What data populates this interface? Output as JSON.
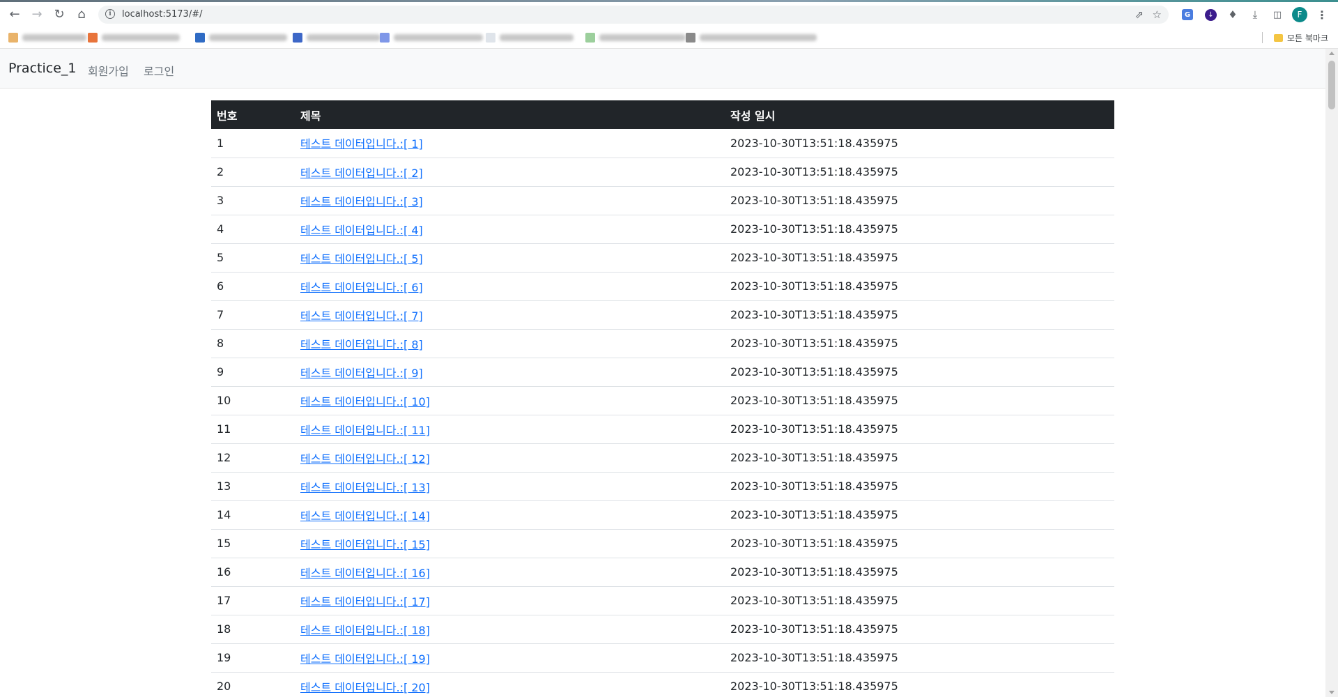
{
  "browser": {
    "url": "localhost:5173/#/",
    "bookmarks_folder": "모든 북마크",
    "profile_initial": "F",
    "icons": [
      "back-icon",
      "forward-icon",
      "reload-icon",
      "home-icon",
      "info-icon",
      "share-icon",
      "star-icon",
      "translate-icon",
      "download-ext-icon",
      "puzzle-icon",
      "download-icon",
      "sidepanel-icon",
      "menu-icon"
    ]
  },
  "navbar": {
    "brand": "Practice_1",
    "links": [
      "회원가입",
      "로그인"
    ]
  },
  "table": {
    "headers": [
      "번호",
      "제목",
      "작성 일시"
    ],
    "rows": [
      {
        "no": "1",
        "title": "테스트 데이터입니다.:[ 1]",
        "created": "2023-10-30T13:51:18.435975"
      },
      {
        "no": "2",
        "title": "테스트 데이터입니다.:[ 2]",
        "created": "2023-10-30T13:51:18.435975"
      },
      {
        "no": "3",
        "title": "테스트 데이터입니다.:[ 3]",
        "created": "2023-10-30T13:51:18.435975"
      },
      {
        "no": "4",
        "title": "테스트 데이터입니다.:[ 4]",
        "created": "2023-10-30T13:51:18.435975"
      },
      {
        "no": "5",
        "title": "테스트 데이터입니다.:[ 5]",
        "created": "2023-10-30T13:51:18.435975"
      },
      {
        "no": "6",
        "title": "테스트 데이터입니다.:[ 6]",
        "created": "2023-10-30T13:51:18.435975"
      },
      {
        "no": "7",
        "title": "테스트 데이터입니다.:[ 7]",
        "created": "2023-10-30T13:51:18.435975"
      },
      {
        "no": "8",
        "title": "테스트 데이터입니다.:[ 8]",
        "created": "2023-10-30T13:51:18.435975"
      },
      {
        "no": "9",
        "title": "테스트 데이터입니다.:[ 9]",
        "created": "2023-10-30T13:51:18.435975"
      },
      {
        "no": "10",
        "title": "테스트 데이터입니다.:[ 10]",
        "created": "2023-10-30T13:51:18.435975"
      },
      {
        "no": "11",
        "title": "테스트 데이터입니다.:[ 11]",
        "created": "2023-10-30T13:51:18.435975"
      },
      {
        "no": "12",
        "title": "테스트 데이터입니다.:[ 12]",
        "created": "2023-10-30T13:51:18.435975"
      },
      {
        "no": "13",
        "title": "테스트 데이터입니다.:[ 13]",
        "created": "2023-10-30T13:51:18.435975"
      },
      {
        "no": "14",
        "title": "테스트 데이터입니다.:[ 14]",
        "created": "2023-10-30T13:51:18.435975"
      },
      {
        "no": "15",
        "title": "테스트 데이터입니다.:[ 15]",
        "created": "2023-10-30T13:51:18.435975"
      },
      {
        "no": "16",
        "title": "테스트 데이터입니다.:[ 16]",
        "created": "2023-10-30T13:51:18.435975"
      },
      {
        "no": "17",
        "title": "테스트 데이터입니다.:[ 17]",
        "created": "2023-10-30T13:51:18.435975"
      },
      {
        "no": "18",
        "title": "테스트 데이터입니다.:[ 18]",
        "created": "2023-10-30T13:51:18.435975"
      },
      {
        "no": "19",
        "title": "테스트 데이터입니다.:[ 19]",
        "created": "2023-10-30T13:51:18.435975"
      },
      {
        "no": "20",
        "title": "테스트 데이터입니다.:[ 20]",
        "created": "2023-10-30T13:51:18.435975"
      }
    ]
  }
}
